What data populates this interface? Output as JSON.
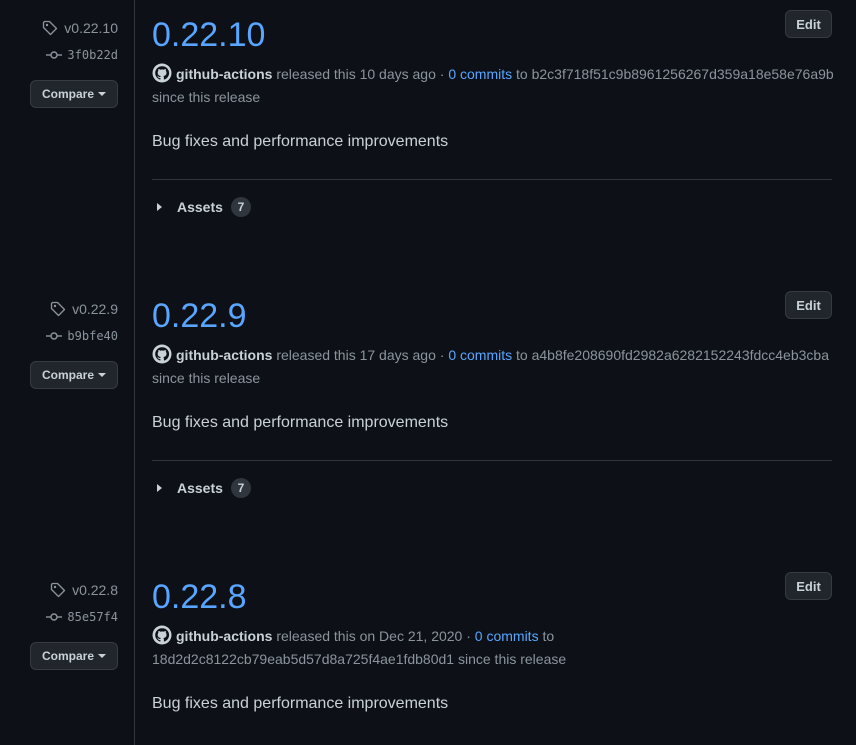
{
  "releases": [
    {
      "tag": "v0.22.10",
      "commit": "3f0b22d",
      "compare_label": "Compare",
      "title": "0.22.10",
      "edit_label": "Edit",
      "author": "github-actions",
      "released_text": " released this 10 days ago · ",
      "commits_link": "0 commits",
      "to_text": " to ",
      "target_hash": "b2c3f718f51c9b8961256267d359a18e58e76a9b",
      "since_text": " since this release",
      "notes": "Bug fixes and performance improvements",
      "assets_label": "Assets",
      "assets_count": "7"
    },
    {
      "tag": "v0.22.9",
      "commit": "b9bfe40",
      "compare_label": "Compare",
      "title": "0.22.9",
      "edit_label": "Edit",
      "author": "github-actions",
      "released_text": " released this 17 days ago · ",
      "commits_link": "0 commits",
      "to_text": " to ",
      "target_hash": "a4b8fe208690fd2982a6282152243fdcc4eb3cba",
      "since_text": " since this release",
      "notes": "Bug fixes and performance improvements",
      "assets_label": "Assets",
      "assets_count": "7"
    },
    {
      "tag": "v0.22.8",
      "commit": "85e57f4",
      "compare_label": "Compare",
      "title": "0.22.8",
      "edit_label": "Edit",
      "author": "github-actions",
      "released_text": " released this on Dec 21, 2020 · ",
      "commits_link": "0 commits",
      "to_text": " to ",
      "target_hash": "18d2d2c8122cb79eab5d57d8a725f4ae1fdb80d1",
      "since_text": " since this release",
      "notes": "Bug fixes and performance improvements"
    }
  ],
  "colors": {
    "background": "#0d1117",
    "link": "#58a6ff",
    "muted": "#8b949e",
    "text": "#c9d1d9",
    "border": "#30363d"
  },
  "icons": {
    "tag": "tag-icon",
    "commit": "git-commit-icon",
    "author": "github-logo-icon",
    "compare": "triangle-down-icon",
    "assets": "triangle-right-icon"
  }
}
